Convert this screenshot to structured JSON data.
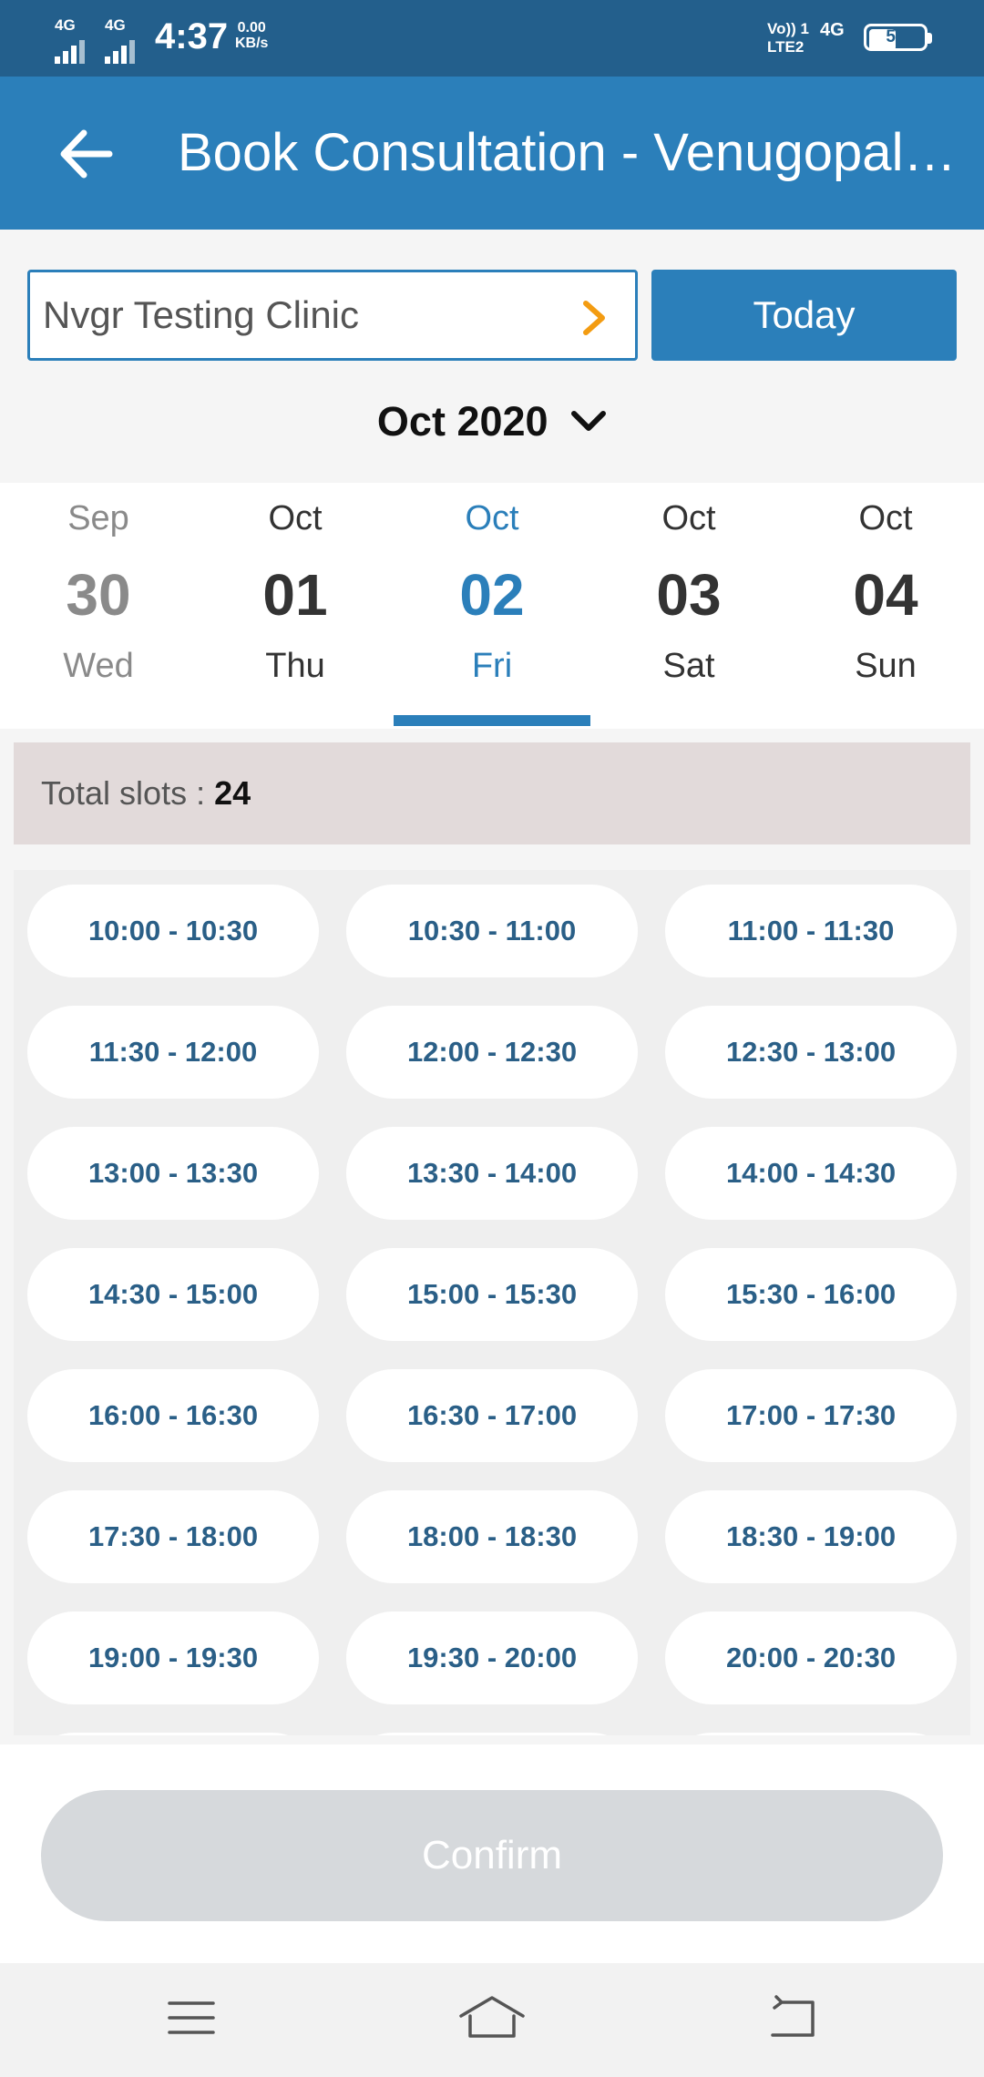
{
  "status_bar": {
    "net1": "4G",
    "net2": "4G",
    "time": "4:37",
    "speed_value": "0.00",
    "speed_unit": "KB/s",
    "volte_top": "Vo)) 1",
    "volte_bottom": "LTE2",
    "net3": "4G",
    "battery": "51"
  },
  "app_bar": {
    "title": "Book Consultation - Venugopal…",
    "back_icon": "arrow-left-icon"
  },
  "clinic_selector": {
    "label": "Nvgr Testing Clinic",
    "chevron_color": "#f39c12"
  },
  "today_button": "Today",
  "month_selector": "Oct 2020",
  "dates": [
    {
      "month": "Sep",
      "day": "30",
      "weekday": "Wed",
      "state": "past"
    },
    {
      "month": "Oct",
      "day": "01",
      "weekday": "Thu",
      "state": "normal"
    },
    {
      "month": "Oct",
      "day": "02",
      "weekday": "Fri",
      "state": "selected"
    },
    {
      "month": "Oct",
      "day": "03",
      "weekday": "Sat",
      "state": "normal"
    },
    {
      "month": "Oct",
      "day": "04",
      "weekday": "Sun",
      "state": "normal"
    }
  ],
  "total_slots": {
    "label": "Total slots : ",
    "value": "24"
  },
  "slots": [
    "10:00 - 10:30",
    "10:30 - 11:00",
    "11:00 - 11:30",
    "11:30 - 12:00",
    "12:00 - 12:30",
    "12:30 - 13:00",
    "13:00 - 13:30",
    "13:30 - 14:00",
    "14:00 - 14:30",
    "14:30 - 15:00",
    "15:00 - 15:30",
    "15:30 - 16:00",
    "16:00 - 16:30",
    "16:30 - 17:00",
    "17:00 - 17:30",
    "17:30 - 18:00",
    "18:00 - 18:30",
    "18:30 - 19:00",
    "19:00 - 19:30",
    "19:30 - 20:00",
    "20:00 - 20:30"
  ],
  "confirm_button": "Confirm",
  "colors": {
    "primary": "#2b7fba",
    "status_bar": "#235f8c",
    "slot_text": "#2a5f87",
    "total_bg": "#e2dada",
    "confirm_disabled": "#d6d9dc"
  }
}
